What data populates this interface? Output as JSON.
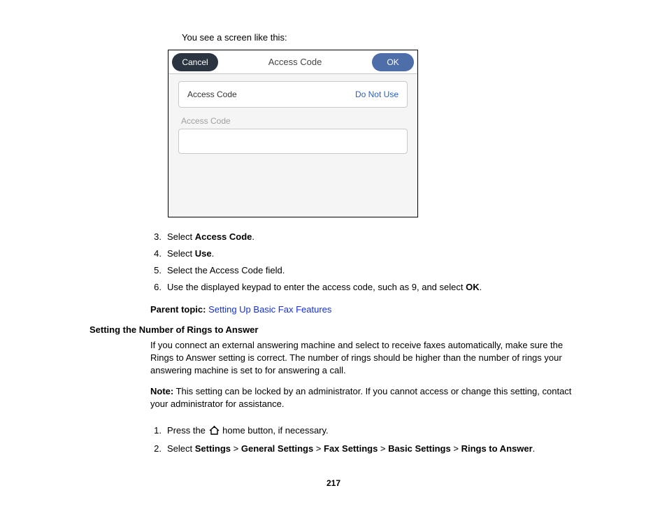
{
  "intro": "You see a screen like this:",
  "device": {
    "cancel": "Cancel",
    "title": "Access Code",
    "ok": "OK",
    "row_label": "Access Code",
    "row_value": "Do Not Use",
    "caption": "Access Code"
  },
  "steps_a": [
    {
      "n": "3.",
      "pre": "Select ",
      "b": "Access Code",
      "post": "."
    },
    {
      "n": "4.",
      "pre": "Select ",
      "b": "Use",
      "post": "."
    },
    {
      "n": "5.",
      "pre": "Select the Access Code field.",
      "b": "",
      "post": ""
    },
    {
      "n": "6.",
      "pre": "Use the displayed keypad to enter the access code, such as 9, and select ",
      "b": "OK",
      "post": "."
    }
  ],
  "parent_topic_label": "Parent topic: ",
  "parent_topic_link": "Setting Up Basic Fax Features",
  "section_title": "Setting the Number of Rings to Answer",
  "para1": "If you connect an external answering machine and select to receive faxes automatically, make sure the Rings to Answer setting is correct. The number of rings should be higher than the number of rings your answering machine is set to for answering a call.",
  "note_label": "Note:",
  "note_text": " This setting can be locked by an administrator. If you cannot access or change this setting, contact your administrator for assistance.",
  "steps_b": {
    "s1_n": "1.",
    "s1_a": "Press the ",
    "s1_b": " home button, if necessary.",
    "s2_n": "2.",
    "s2_pre": "Select ",
    "s2_path": [
      "Settings",
      "General Settings",
      "Fax Settings",
      "Basic Settings",
      "Rings to Answer"
    ],
    "s2_sep": " > ",
    "s2_end": "."
  },
  "page_number": "217"
}
